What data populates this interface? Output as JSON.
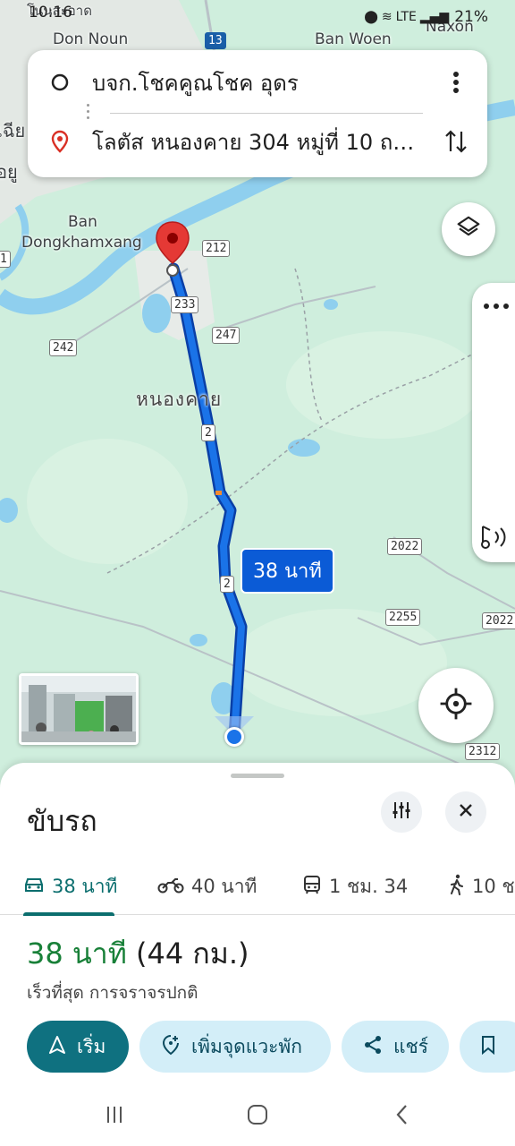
{
  "status_bar": {
    "time": "10:16",
    "battery": "21%",
    "network": "LTE"
  },
  "map": {
    "place_labels": {
      "top_left": "โนนสะอาด",
      "don_noun": "Don Noun",
      "ban_woen": "Ban Woen",
      "naxon": "Naxon",
      "ban": "Ban",
      "dongkhamxang": "Dongkhamxang",
      "nong_khai": "หนองคาย",
      "left_edge_1": "เฉีย",
      "left_edge_2": "อยู"
    },
    "road_shields": {
      "r13": "13",
      "r212": "212",
      "r233": "233",
      "r247": "247",
      "r242": "242",
      "r2a": "2",
      "r2b": "2",
      "r2022a": "2022",
      "r2255": "2255",
      "r2022b": "2022",
      "r2312": "2312",
      "r1": "1"
    },
    "route_duration_label": "38 นาที",
    "route": {
      "color": "#0b5bd6",
      "origin_marker": "blue-dot",
      "destination_marker": "red-pin"
    }
  },
  "route_card": {
    "origin": "บจก.โชคคูณโชค อุดร",
    "destination": "โลตัส หนองคาย 304 หมู่ที่ 10 ถ....",
    "origin_icon": "circle-outline-icon",
    "destination_icon": "location-pin-icon",
    "more_icon": "more-vertical-icon",
    "swap_icon": "swap-vertical-icon"
  },
  "sheet": {
    "title": "ขับรถ",
    "options_icon": "tune-icon",
    "close_icon": "close-icon",
    "modes": [
      {
        "icon": "car-icon",
        "label": "38 นาที",
        "active": true
      },
      {
        "icon": "motorcycle-icon",
        "label": "40 นาที",
        "active": false
      },
      {
        "icon": "transit-icon",
        "label": "1 ชม. 34",
        "active": false
      },
      {
        "icon": "walk-icon",
        "label": "10 ช",
        "active": false
      }
    ],
    "summary_time": "38 นาที",
    "summary_distance": "(44 กม.)",
    "subtitle": "เร็วที่สุด การจราจรปกติ",
    "actions": {
      "start": "เริ่ม",
      "add_stop": "เพิ่มจุดแวะพัก",
      "share": "แชร์"
    }
  },
  "colors": {
    "accent": "#0f7180",
    "route": "#0b5bd6",
    "summary_time": "#188038",
    "map_bg": "#cfeedd",
    "water": "#8fcfee"
  }
}
